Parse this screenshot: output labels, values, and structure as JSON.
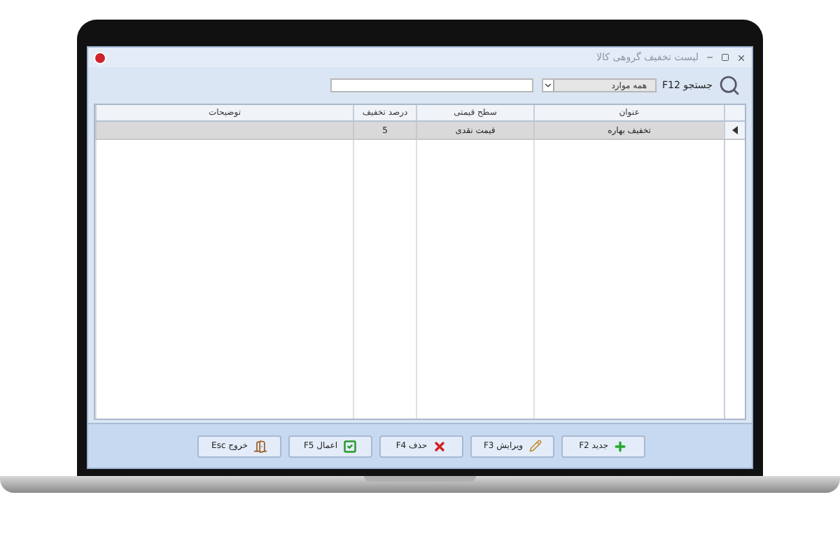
{
  "window": {
    "title": "لیست تخفیف گروهی کالا"
  },
  "search": {
    "label": "جستجو F12",
    "filter": "همه موارد"
  },
  "table": {
    "columns": [
      "عنوان",
      "سطح قیمتی",
      "درصد تخفیف",
      "توضیحات"
    ],
    "rows": [
      {
        "cells": [
          "تخفیف بهاره",
          "قیمت نقدی",
          "5",
          ""
        ],
        "selected": true
      }
    ]
  },
  "buttons": [
    {
      "kind": "new",
      "label": "جدید F2"
    },
    {
      "kind": "edit",
      "label": "ویرایش F3"
    },
    {
      "kind": "delete",
      "label": "حذف F4"
    },
    {
      "kind": "apply",
      "label": "اعمال F5"
    },
    {
      "kind": "exit",
      "label": "خروج Esc"
    }
  ]
}
